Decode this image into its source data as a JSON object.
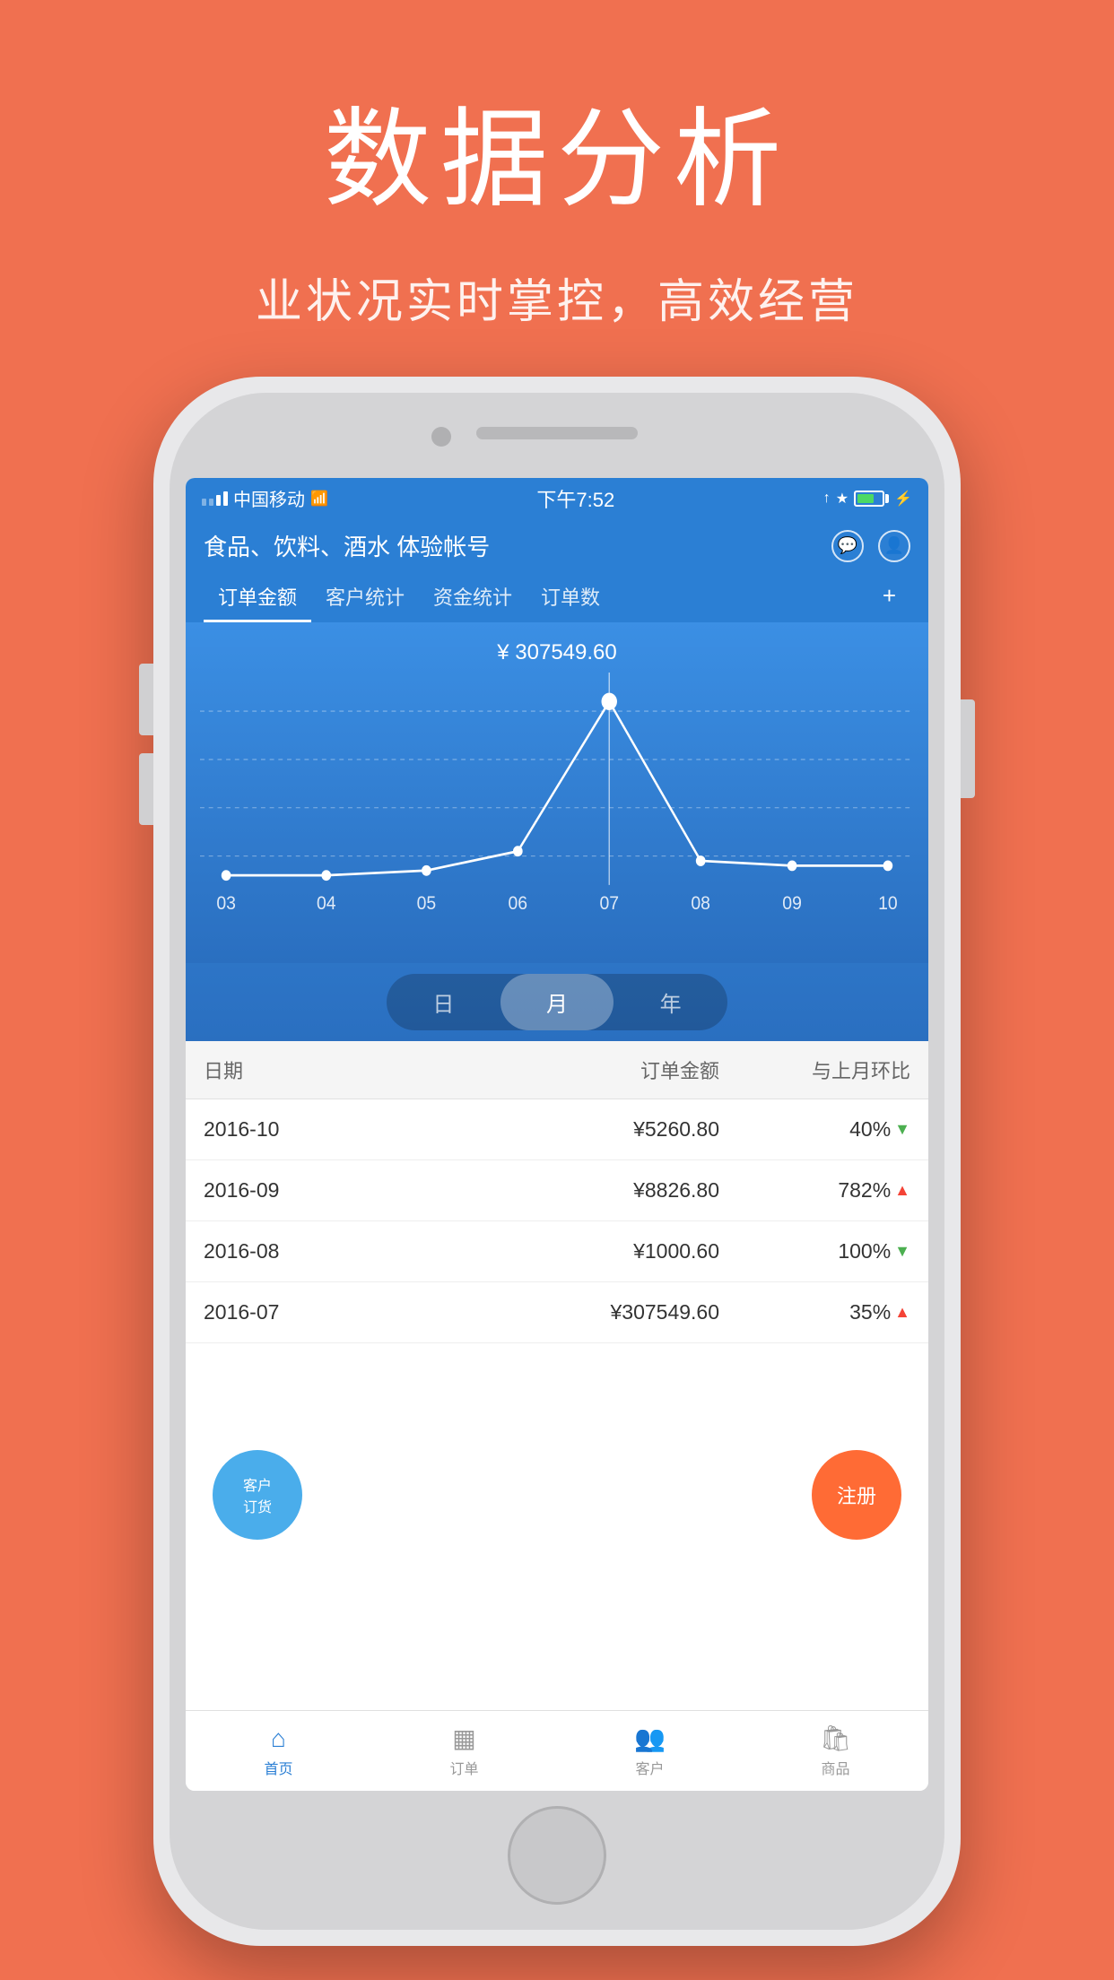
{
  "hero": {
    "title": "数据分析",
    "subtitle": "业状况实时掌控，高效经营"
  },
  "status_bar": {
    "carrier": "中国移动",
    "time": "下午7:52"
  },
  "app": {
    "title": "食品、饮料、酒水 体验帐号",
    "tabs": [
      {
        "label": "订单金额",
        "active": true
      },
      {
        "label": "客户统计",
        "active": false
      },
      {
        "label": "资金统计",
        "active": false
      },
      {
        "label": "订单数",
        "active": false
      }
    ],
    "plus_label": "+"
  },
  "chart": {
    "selected_value": "¥ 307549.60",
    "x_labels": [
      "03",
      "04",
      "05",
      "06",
      "07",
      "08",
      "09",
      "10"
    ],
    "toggle": {
      "day": "日",
      "month": "月",
      "year": "年",
      "active": "month"
    }
  },
  "table": {
    "headers": [
      "日期",
      "订单金额",
      "与上月环比"
    ],
    "rows": [
      {
        "date": "2016-10",
        "amount": "¥5260.80",
        "change": "40%",
        "direction": "down"
      },
      {
        "date": "2016-09",
        "amount": "¥8826.80",
        "change": "782%",
        "direction": "up"
      },
      {
        "date": "2016-08",
        "amount": "¥1000.60",
        "change": "100%",
        "direction": "down"
      },
      {
        "date": "2016-07",
        "amount": "¥307549.60",
        "change": "35%",
        "direction": "up"
      }
    ]
  },
  "floating_buttons": {
    "customer": "客户\n订货",
    "register": "注册"
  },
  "bottom_nav": [
    {
      "label": "首页",
      "active": true,
      "icon": "home"
    },
    {
      "label": "订单",
      "active": false,
      "icon": "order"
    },
    {
      "label": "客户",
      "active": false,
      "icon": "customer"
    },
    {
      "label": "商品",
      "active": false,
      "icon": "product"
    }
  ]
}
